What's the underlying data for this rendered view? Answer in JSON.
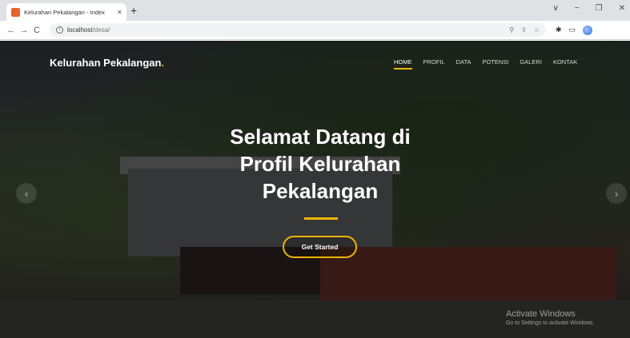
{
  "browser": {
    "tab_title": "Kelurahan Pekalangan - Index",
    "tab_close": "×",
    "new_tab": "+",
    "url_host": "localhost",
    "url_path": "/desa/",
    "nav": {
      "back": "←",
      "forward": "→",
      "reload": "C"
    },
    "window_controls": {
      "dropdown": "∨",
      "minimize": "−",
      "maximize": "❐",
      "close": "✕"
    },
    "omni_icons": {
      "search": "⚲",
      "share": "⇪",
      "bookmark": "☆"
    },
    "ext_icons": {
      "extensions": "✱",
      "sidepanel": "▭"
    }
  },
  "site": {
    "brand": "Kelurahan Pekalangan",
    "brand_dot": ".",
    "menu": [
      {
        "label": "HOME",
        "active": true
      },
      {
        "label": "PROFIL",
        "active": false
      },
      {
        "label": "DATA",
        "active": false
      },
      {
        "label": "POTENSI",
        "active": false
      },
      {
        "label": "GALERI",
        "active": false
      },
      {
        "label": "KONTAK",
        "active": false
      }
    ],
    "hero": {
      "line1": "Selamat Datang di",
      "line2": "Profil Kelurahan",
      "line3": "Pekalangan",
      "cta": "Get Started",
      "prev": "‹",
      "next": "›"
    },
    "accent_color": "#f0b400"
  },
  "watermark": {
    "title": "Activate Windows",
    "subtitle": "Go to Settings to activate Windows."
  }
}
